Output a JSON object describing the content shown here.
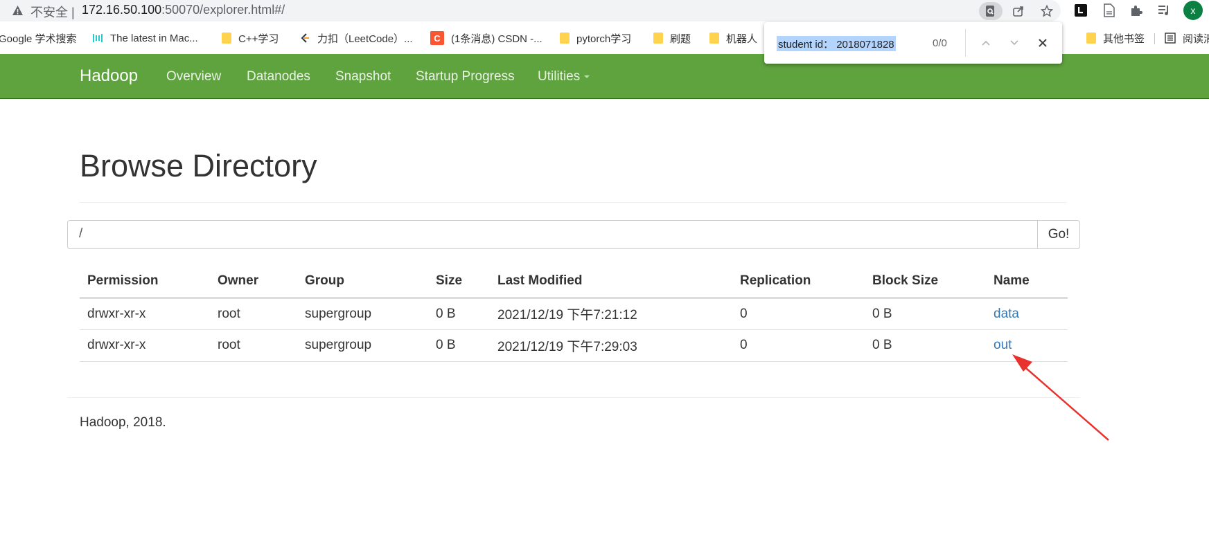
{
  "browser": {
    "security_label": "不安全",
    "separator": "|",
    "url_host": "172.16.50.100",
    "url_rest": ":50070/explorer.html#/",
    "avatar_letter": "x",
    "bookmarks": [
      {
        "label": "Google 学术搜索",
        "icon": "scholar-icon"
      },
      {
        "label": "The latest in Mac...",
        "icon": "paperswithcode-icon"
      },
      {
        "label": "C++学习",
        "icon": "folder-icon"
      },
      {
        "label": "力扣（LeetCode）...",
        "icon": "leetcode-icon"
      },
      {
        "label": "(1条消息) CSDN -...",
        "icon": "csdn-icon"
      },
      {
        "label": "pytorch学习",
        "icon": "folder-icon"
      },
      {
        "label": "刷题",
        "icon": "folder-icon"
      },
      {
        "label": "机器人",
        "icon": "folder-icon"
      },
      {
        "label": "其他书签",
        "icon": "folder-icon"
      },
      {
        "label": "阅读清",
        "icon": "reading-list-icon"
      }
    ],
    "find": {
      "query": "student id： 2018071828",
      "count": "0/0"
    }
  },
  "navbar": {
    "brand": "Hadoop",
    "links": [
      "Overview",
      "Datanodes",
      "Snapshot",
      "Startup Progress",
      "Utilities"
    ]
  },
  "main": {
    "title": "Browse Directory",
    "path_value": "/",
    "go_label": "Go!",
    "columns": [
      "Permission",
      "Owner",
      "Group",
      "Size",
      "Last Modified",
      "Replication",
      "Block Size",
      "Name"
    ],
    "rows": [
      {
        "permission": "drwxr-xr-x",
        "owner": "root",
        "group": "supergroup",
        "size": "0 B",
        "modified": "2021/12/19 下午7:21:12",
        "replication": "0",
        "block_size": "0 B",
        "name": "data"
      },
      {
        "permission": "drwxr-xr-x",
        "owner": "root",
        "group": "supergroup",
        "size": "0 B",
        "modified": "2021/12/19 下午7:29:03",
        "replication": "0",
        "block_size": "0 B",
        "name": "out"
      }
    ]
  },
  "footer": {
    "text": "Hadoop, 2018."
  },
  "colors": {
    "navbar": "#5fa33e",
    "link": "#337ab7",
    "annotation_arrow": "#e8322e"
  }
}
